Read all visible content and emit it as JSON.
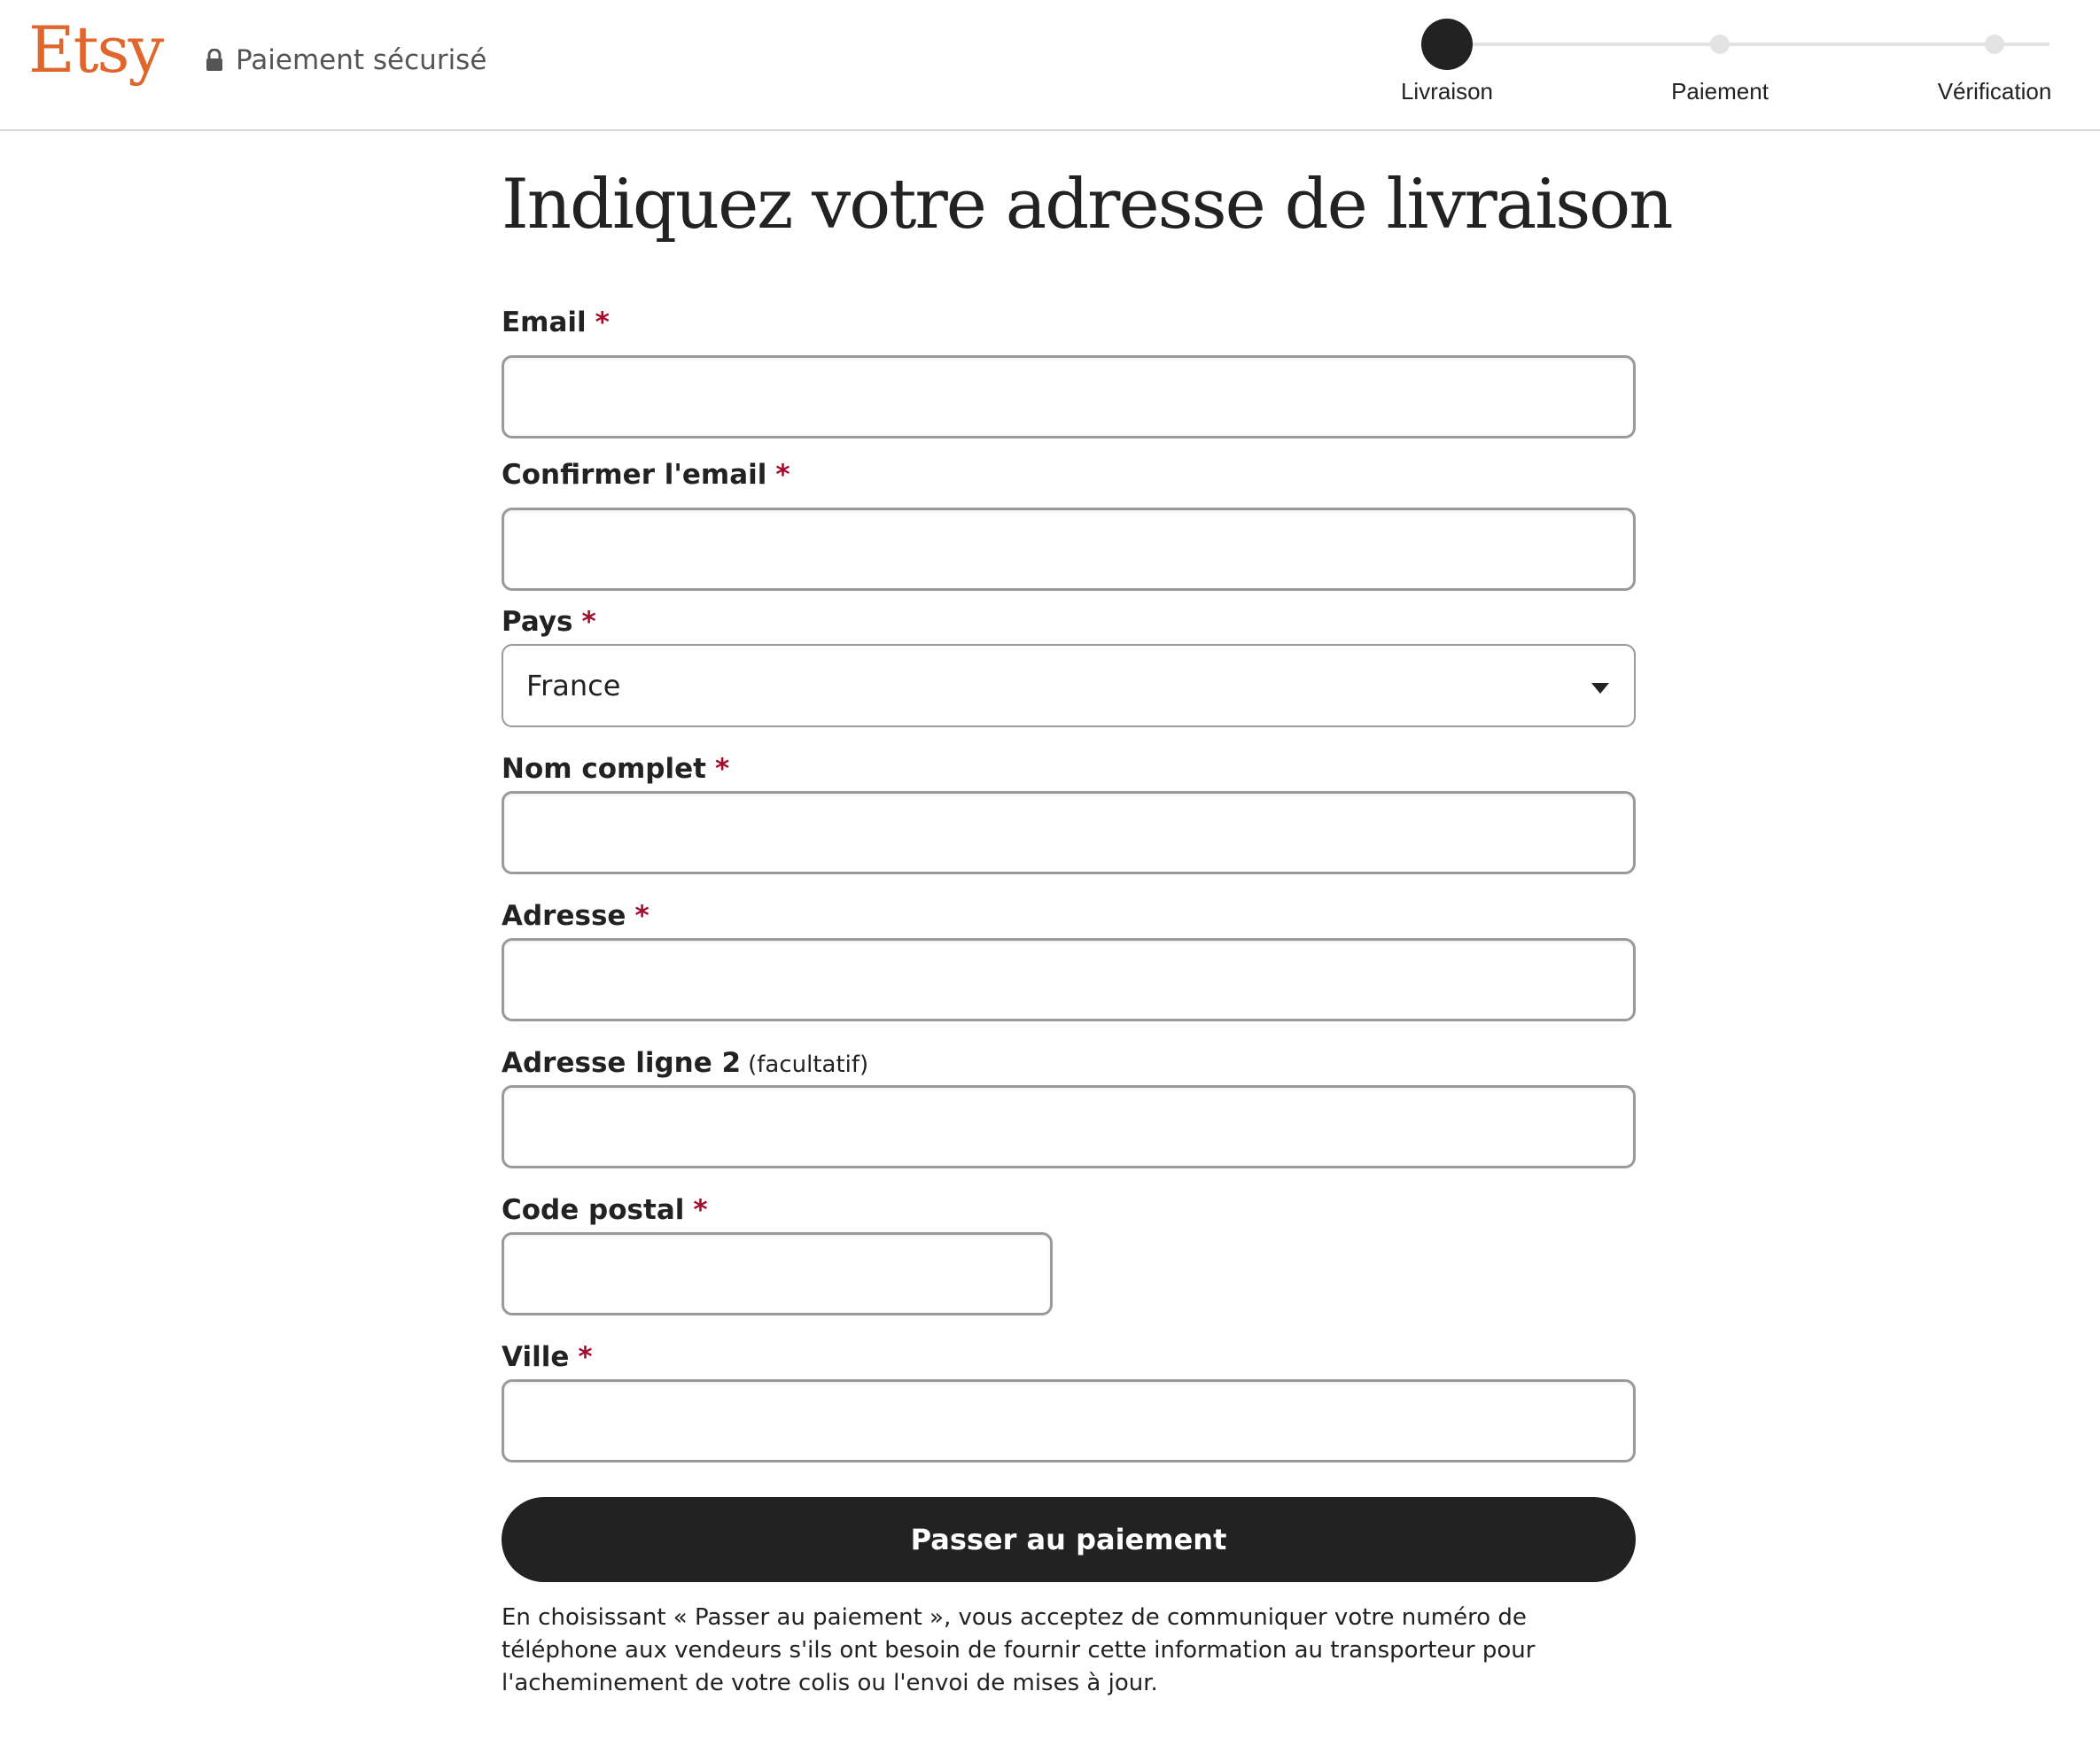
{
  "header": {
    "logo": "Etsy",
    "secure_label": "Paiement sécurisé"
  },
  "steps": [
    {
      "label": "Livraison",
      "state": "active"
    },
    {
      "label": "Paiement",
      "state": "pending"
    },
    {
      "label": "Vérification",
      "state": "pending"
    }
  ],
  "form": {
    "title": "Indiquez votre adresse de livraison",
    "required_mark": "*",
    "email": {
      "label": "Email",
      "value": ""
    },
    "confirm_email": {
      "label": "Confirmer l'email",
      "value": ""
    },
    "country": {
      "label": "Pays",
      "value": "France"
    },
    "full_name": {
      "label": "Nom complet",
      "value": ""
    },
    "address": {
      "label": "Adresse",
      "value": ""
    },
    "address2": {
      "label": "Adresse ligne 2",
      "optional": "(facultatif)",
      "value": ""
    },
    "postal_code": {
      "label": "Code postal",
      "value": ""
    },
    "city": {
      "label": "Ville",
      "value": ""
    },
    "submit_label": "Passer au paiement",
    "disclaimer": "En choisissant « Passer au paiement », vous acceptez de communiquer votre numéro de téléphone aux vendeurs s'ils ont besoin de fournir cette information au transporteur pour l'acheminement de votre colis ou l'envoi de mises à jour."
  },
  "colors": {
    "brand": "#e0662b",
    "required": "#a30d2d",
    "button": "#222222"
  },
  "icons": {
    "secure": "lock-icon",
    "select": "caret-down-icon"
  }
}
